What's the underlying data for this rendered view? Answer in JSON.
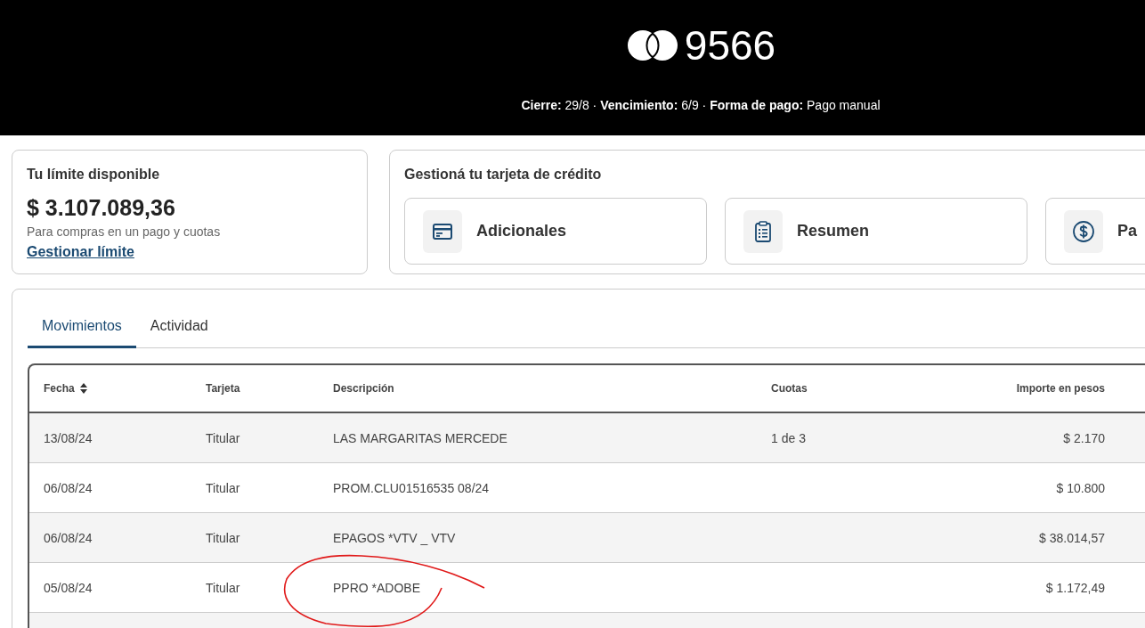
{
  "header": {
    "card_number": "9566",
    "details": "**Cierre:** 29/8 · **Vencimiento:** 6/9 · **Forma de pago:** Pago manual"
  },
  "limit_card": {
    "title": "Tu límite disponible",
    "amount": "$ 3.107.089,36",
    "note": "Para compras en un pago y cuotas",
    "link": "Gestionar límite"
  },
  "manage_card": {
    "title": "Gestioná tu tarjeta de crédito",
    "actions": [
      {
        "label": "Adicionales"
      },
      {
        "label": "Resumen"
      },
      {
        "label": "Pa"
      }
    ]
  },
  "tabs": [
    {
      "label": "Movimientos",
      "selected": true
    },
    {
      "label": "Actividad",
      "selected": false
    }
  ],
  "table": {
    "columns": [
      {
        "label": "Fecha",
        "sortable": true
      },
      {
        "label": "Tarjeta",
        "sortable": false
      },
      {
        "label": "Descripción",
        "sortable": false
      },
      {
        "label": "Cuotas",
        "sortable": false
      },
      {
        "label": "Importe en pesos",
        "sortable": false
      }
    ],
    "rows": [
      {
        "cells": [
          "13/08/24",
          "Titular",
          "LAS MARGARITAS MERCEDE",
          "1 de 3",
          "$ 2.170"
        ]
      },
      {
        "cells": [
          "06/08/24",
          "Titular",
          "PROM.CLU01516535 08/24",
          "",
          "$ 10.800"
        ]
      },
      {
        "cells": [
          "06/08/24",
          "Titular",
          "EPAGOS *VTV _ VTV",
          "",
          "$ 38.014,57"
        ]
      },
      {
        "cells": [
          "05/08/24",
          "Titular",
          "PPRO *ADOBE",
          "",
          "$ 1.172,49"
        ]
      }
    ]
  }
}
